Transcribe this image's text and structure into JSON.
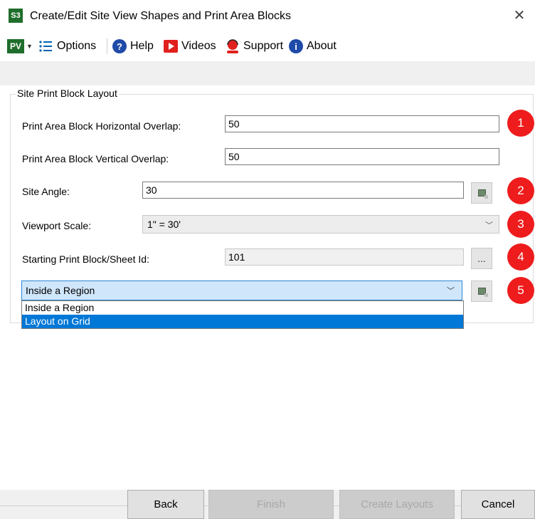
{
  "window": {
    "app_icon_text": "S3",
    "title": "Create/Edit Site View Shapes and Print Area Blocks",
    "close_glyph": "✕"
  },
  "menu": {
    "logo_text": "PV",
    "options": "Options",
    "help": "Help",
    "videos": "Videos",
    "support": "Support",
    "about": "About"
  },
  "group": {
    "legend": "Site Print Block Layout",
    "horizontal_overlap": {
      "label": "Print Area Block Horizontal Overlap:",
      "value": "50"
    },
    "vertical_overlap": {
      "label": "Print Area Block Vertical Overlap:",
      "value": "50"
    },
    "site_angle": {
      "label": "Site Angle:",
      "value": "30"
    },
    "viewport_scale": {
      "label": "Viewport Scale:",
      "value": "1\" = 30'"
    },
    "starting_id": {
      "label": "Starting Print Block/Sheet Id:",
      "value": "101",
      "browse_label": "..."
    },
    "layout_mode": {
      "value": "Inside a Region",
      "options": [
        "Inside a Region",
        "Layout on Grid"
      ],
      "highlighted": "Layout on Grid"
    }
  },
  "badges": [
    "1",
    "2",
    "3",
    "4",
    "5"
  ],
  "footer": {
    "back": "Back",
    "finish": "Finish",
    "create_layouts": "Create Layouts",
    "cancel": "Cancel"
  },
  "colors": {
    "badge_red": "#ee1c1c",
    "selection_blue": "#0078d7",
    "brand_green": "#1f6e2b"
  }
}
